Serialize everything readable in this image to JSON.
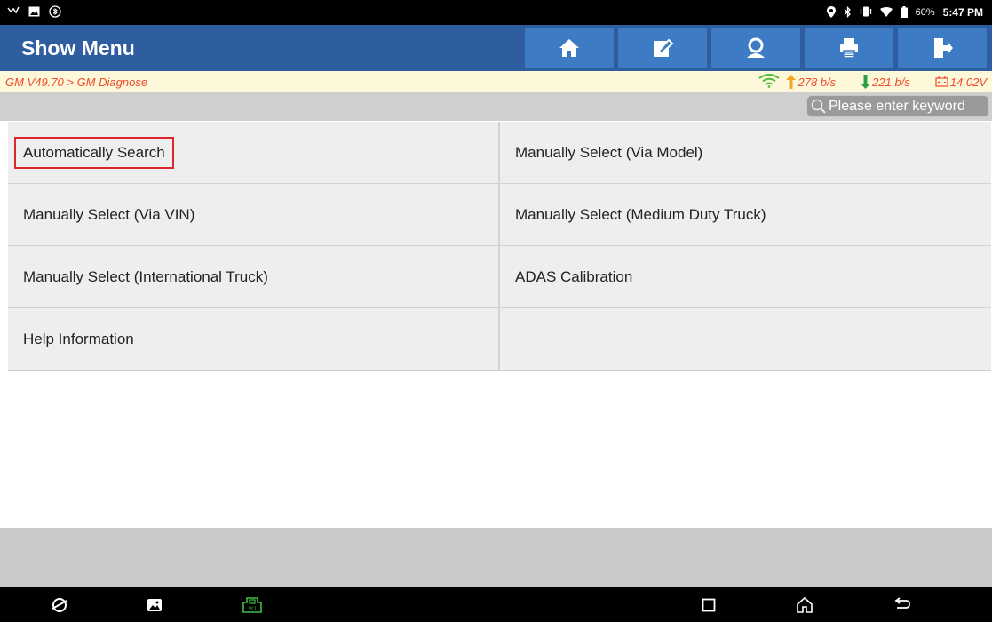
{
  "status_bar": {
    "battery": "60%",
    "time": "5:47 PM"
  },
  "header": {
    "title": "Show Menu",
    "buttons": [
      "home-icon",
      "edit-icon",
      "user-icon",
      "print-icon",
      "exit-icon"
    ]
  },
  "breadcrumb": {
    "path": "GM V49.70 > GM Diagnose",
    "upload_speed": "278 b/s",
    "download_speed": "221 b/s",
    "voltage": "14.02V"
  },
  "search": {
    "placeholder": "Please enter keyword"
  },
  "menu": {
    "items": [
      "Automatically Search",
      "Manually Select (Via Model)",
      "Manually Select (Via VIN)",
      "Manually Select (Medium Duty Truck)",
      "Manually Select (International Truck)",
      "ADAS Calibration",
      "Help Information",
      ""
    ],
    "highlighted_index": 0
  },
  "colors": {
    "title_bar": "#2f5ea0",
    "title_button": "#3d7bc4",
    "breadcrumb_bg": "#fdf8d9",
    "breadcrumb_text": "#f04a2a",
    "highlight": "#e0262d",
    "upload_arrow": "#f5a623",
    "download_arrow": "#2ea043"
  }
}
